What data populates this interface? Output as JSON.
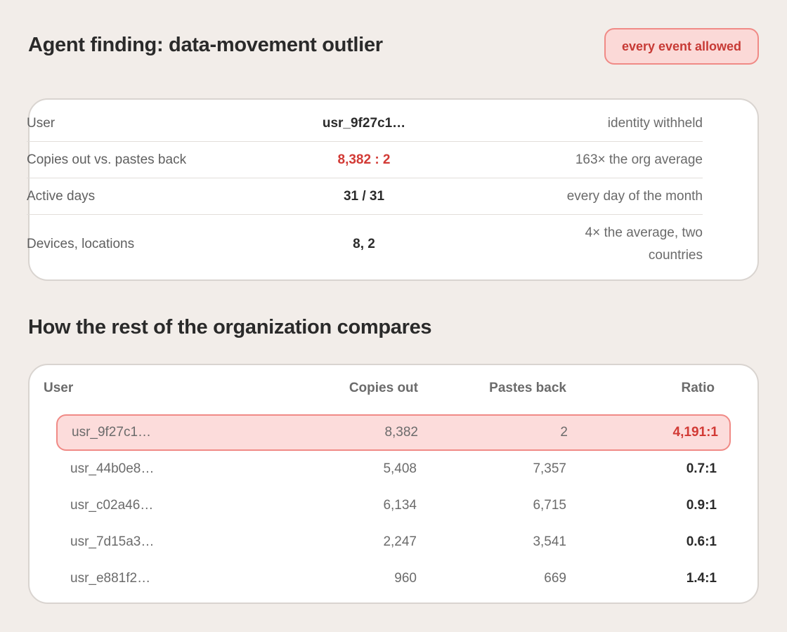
{
  "header": {
    "title": "Agent finding: data-movement outlier",
    "badge": "every event allowed"
  },
  "summary": {
    "rows": [
      {
        "label": "User",
        "value": "usr_9f27c1…",
        "note": "identity withheld"
      },
      {
        "label": "Copies out vs. pastes back",
        "value": "8,382 : 2",
        "note": "163× the org average"
      },
      {
        "label": "Active days",
        "value": "31 / 31",
        "note": "every day of the month"
      },
      {
        "label": "Devices, locations",
        "value": "8, 2",
        "note": "4× the average, two countries"
      }
    ]
  },
  "comparison": {
    "title": "How the rest of the organization compares",
    "columns": [
      "User",
      "Copies out",
      "Pastes back",
      "Ratio"
    ],
    "rows": [
      {
        "user": "usr_9f27c1…",
        "copies": "8,382",
        "pastes": "2",
        "ratio": "4,191:1"
      },
      {
        "user": "usr_44b0e8…",
        "copies": "5,408",
        "pastes": "7,357",
        "ratio": "0.7:1"
      },
      {
        "user": "usr_c02a46…",
        "copies": "6,134",
        "pastes": "6,715",
        "ratio": "0.9:1"
      },
      {
        "user": "usr_7d15a3…",
        "copies": "2,247",
        "pastes": "3,541",
        "ratio": "0.6:1"
      },
      {
        "user": "usr_e881f2…",
        "copies": "960",
        "pastes": "669",
        "ratio": "1.4:1"
      }
    ]
  },
  "colors": {
    "background": "#f2ede9",
    "alert": "#d23a35",
    "alert_fill": "#fcdcdb",
    "alert_border": "#f08a86"
  }
}
